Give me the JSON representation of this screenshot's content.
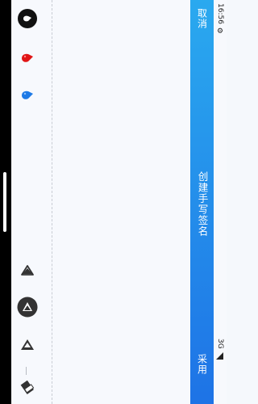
{
  "header": {
    "title": "创建手写签名",
    "cancel_label": "取消",
    "confirm_label": "采用"
  },
  "status_bar": {
    "time": "16:56",
    "network": "3G"
  },
  "palette": {
    "colors": [
      {
        "name": "black",
        "hex": "#111111",
        "selected": true
      },
      {
        "name": "red",
        "hex": "#e01515",
        "selected": false
      },
      {
        "name": "blue",
        "hex": "#1e7ae6",
        "selected": false
      }
    ],
    "pens": [
      {
        "name": "thin-pen",
        "selected": false
      },
      {
        "name": "medium-pen",
        "selected": true
      },
      {
        "name": "thick-pen",
        "selected": false
      }
    ],
    "eraser": "eraser-icon"
  }
}
